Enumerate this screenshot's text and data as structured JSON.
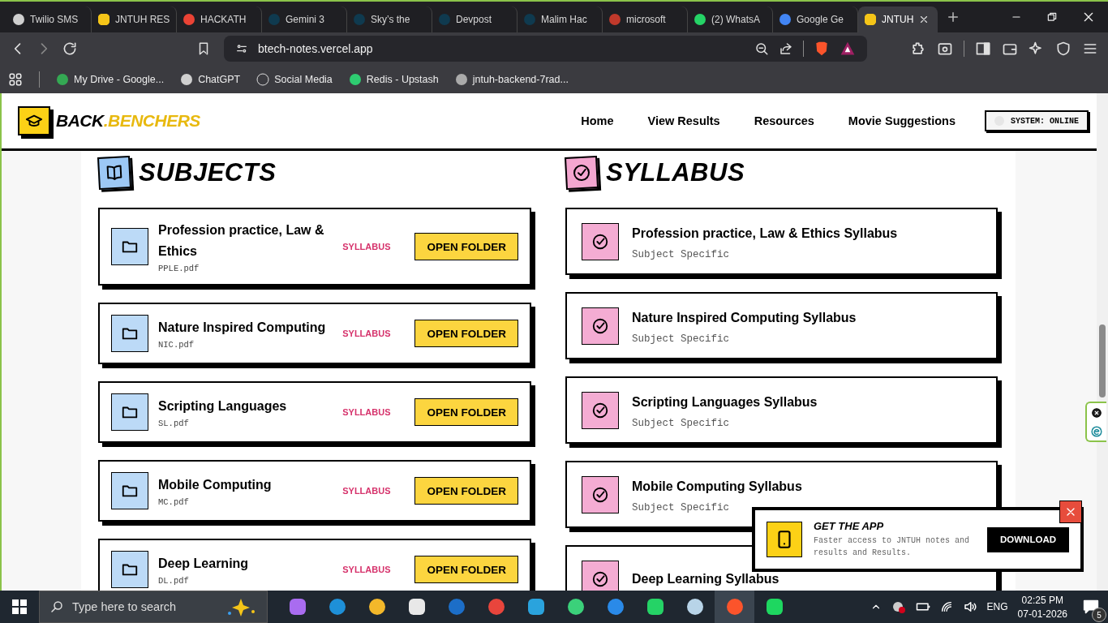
{
  "browser": {
    "tabs": [
      {
        "title": "Twilio SMS",
        "selected": false
      },
      {
        "title": "JNTUH RES",
        "selected": false
      },
      {
        "title": "HACKATH",
        "selected": false
      },
      {
        "title": "Gemini 3",
        "selected": false
      },
      {
        "title": "Sky’s the",
        "selected": false
      },
      {
        "title": "Devpost",
        "selected": false
      },
      {
        "title": "Malim Hac",
        "selected": false
      },
      {
        "title": "microsoft",
        "selected": false
      },
      {
        "title": "(2) WhatsA",
        "selected": false
      },
      {
        "title": "Google Ge",
        "selected": false
      },
      {
        "title": "JNTUH",
        "selected": true
      }
    ],
    "url": "btech-notes.vercel.app",
    "bookmarks": [
      "My Drive - Google...",
      "ChatGPT",
      "Social Media",
      "Redis - Upstash",
      "jntuh-backend-7rad..."
    ]
  },
  "site": {
    "logo": {
      "first": "BACK",
      "second": ".BENCHERS"
    },
    "nav": [
      "Home",
      "View Results",
      "Resources",
      "Movie Suggestions"
    ],
    "status": "SYSTEM: ONLINE"
  },
  "subjects": {
    "title": "SUBJECTS",
    "items": [
      {
        "name": "Profession practice, Law & Ethics",
        "file": "PPLE.pdf",
        "link": "SYLLABUS",
        "button": "OPEN FOLDER"
      },
      {
        "name": "Nature Inspired Computing",
        "file": "NIC.pdf",
        "link": "SYLLABUS",
        "button": "OPEN FOLDER"
      },
      {
        "name": "Scripting Languages",
        "file": "SL.pdf",
        "link": "SYLLABUS",
        "button": "OPEN FOLDER"
      },
      {
        "name": "Mobile Computing",
        "file": "MC.pdf",
        "link": "SYLLABUS",
        "button": "OPEN FOLDER"
      },
      {
        "name": "Deep Learning",
        "file": "DL.pdf",
        "link": "SYLLABUS",
        "button": "OPEN FOLDER"
      }
    ]
  },
  "syllabus": {
    "title": "SYLLABUS",
    "items": [
      {
        "title": "Profession practice, Law & Ethics Syllabus",
        "subtitle": "Subject Specific"
      },
      {
        "title": "Nature Inspired Computing Syllabus",
        "subtitle": "Subject Specific"
      },
      {
        "title": "Scripting Languages Syllabus",
        "subtitle": "Subject Specific"
      },
      {
        "title": "Mobile Computing Syllabus",
        "subtitle": "Subject Specific"
      },
      {
        "title": "Deep Learning Syllabus"
      }
    ]
  },
  "app_banner": {
    "title": "GET THE APP",
    "description": "Faster access to JNTUH notes and results and Results.",
    "button": "DOWNLOAD"
  },
  "taskbar": {
    "search_placeholder": "Type here to search",
    "language": "ENG",
    "time": "02:25 PM",
    "date": "07-01-2026",
    "notifications": "5"
  }
}
